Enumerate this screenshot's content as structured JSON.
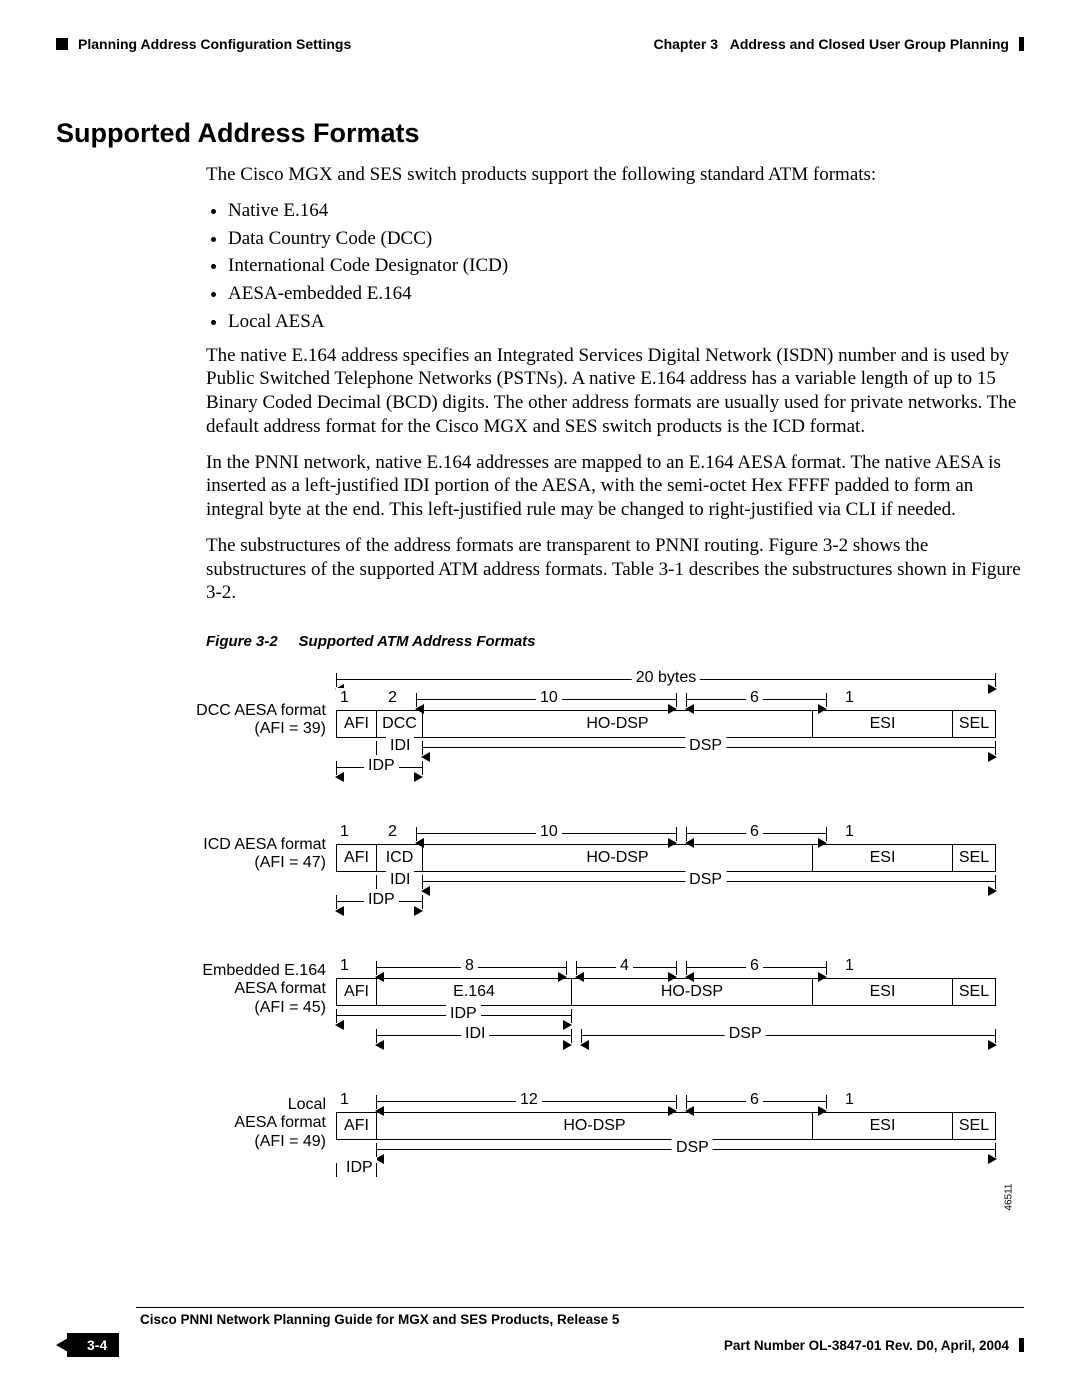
{
  "header": {
    "left": "Planning Address Configuration Settings",
    "right_prefix": "Chapter 3",
    "right_title": "Address and Closed User Group Planning"
  },
  "heading": "Supported Address Formats",
  "intro": "The Cisco MGX and SES switch products support the following standard ATM formats:",
  "bullets": [
    "Native E.164",
    "Data Country Code (DCC)",
    "International Code Designator (ICD)",
    "AESA-embedded E.164",
    "Local AESA"
  ],
  "para1": "The native E.164 address specifies an Integrated Services Digital Network (ISDN) number and is used by Public Switched Telephone Networks (PSTNs). A native E.164 address has a variable length of up to 15 Binary Coded Decimal (BCD) digits. The other address formats are usually used for private networks. The default address format for the Cisco MGX and SES switch products is the ICD format.",
  "para2": "In the PNNI network, native E.164 addresses are mapped to an E.164 AESA format. The native AESA is inserted as a left-justified IDI portion of the AESA, with the semi-octet Hex FFFF padded to form an integral byte at the end. This left-justified rule may be changed to right-justified via CLI if needed.",
  "para3": "The substructures of the address formats are transparent to PNNI routing. Figure 3-2 shows the substructures of the supported ATM address formats. Table 3-1 describes the substructures shown in Figure 3-2.",
  "fig_caption_num": "Figure 3-2",
  "fig_caption_title": "Supported ATM Address Formats",
  "labels": {
    "bytes20": "20 bytes",
    "n1": "1",
    "n2": "2",
    "n4": "4",
    "n6": "6",
    "n8": "8",
    "n10": "10",
    "n12": "12",
    "AFI": "AFI",
    "DCC": "DCC",
    "ICD": "ICD",
    "HODSP": "HO-DSP",
    "ESI": "ESI",
    "SEL": "SEL",
    "E164": "E.164",
    "IDI": "IDI",
    "IDP": "IDP",
    "DSP": "DSP"
  },
  "row_labels": {
    "dcc1": "DCC AESA format",
    "dcc2": "(AFI = 39)",
    "icd1": "ICD AESA format",
    "icd2": "(AFI = 47)",
    "e164_1": "Embedded E.164",
    "e164_2": "AESA format",
    "e164_3": "(AFI = 45)",
    "loc1": "Local",
    "loc2": "AESA format",
    "loc3": "(AFI = 49)"
  },
  "chart_data": {
    "type": "table",
    "total_bytes": 20,
    "formats": [
      {
        "name": "DCC AESA format",
        "afi": 39,
        "fields": [
          {
            "label": "AFI",
            "bytes": 1
          },
          {
            "label": "DCC",
            "bytes": 2
          },
          {
            "label": "HO-DSP",
            "bytes": 10
          },
          {
            "label": "ESI",
            "bytes": 6
          },
          {
            "label": "SEL",
            "bytes": 1
          }
        ],
        "spans": {
          "IDI": [
            "DCC"
          ],
          "IDP": [
            "AFI",
            "DCC"
          ],
          "DSP": [
            "HO-DSP",
            "ESI",
            "SEL"
          ]
        }
      },
      {
        "name": "ICD AESA format",
        "afi": 47,
        "fields": [
          {
            "label": "AFI",
            "bytes": 1
          },
          {
            "label": "ICD",
            "bytes": 2
          },
          {
            "label": "HO-DSP",
            "bytes": 10
          },
          {
            "label": "ESI",
            "bytes": 6
          },
          {
            "label": "SEL",
            "bytes": 1
          }
        ],
        "spans": {
          "IDI": [
            "ICD"
          ],
          "IDP": [
            "AFI",
            "ICD"
          ],
          "DSP": [
            "HO-DSP",
            "ESI",
            "SEL"
          ]
        }
      },
      {
        "name": "Embedded E.164 AESA format",
        "afi": 45,
        "fields": [
          {
            "label": "AFI",
            "bytes": 1
          },
          {
            "label": "E.164",
            "bytes": 8
          },
          {
            "label": "HO-DSP",
            "bytes": 4
          },
          {
            "label": "ESI",
            "bytes": 6
          },
          {
            "label": "SEL",
            "bytes": 1
          }
        ],
        "spans": {
          "IDP": [
            "AFI"
          ],
          "IDI": [
            "AFI",
            "E.164"
          ],
          "DSP": [
            "HO-DSP",
            "ESI",
            "SEL"
          ]
        }
      },
      {
        "name": "Local AESA format",
        "afi": 49,
        "fields": [
          {
            "label": "AFI",
            "bytes": 1
          },
          {
            "label": "HO-DSP",
            "bytes": 12
          },
          {
            "label": "ESI",
            "bytes": 6
          },
          {
            "label": "SEL",
            "bytes": 1
          }
        ],
        "spans": {
          "IDP": [
            "AFI"
          ],
          "DSP": [
            "HO-DSP",
            "ESI",
            "SEL"
          ]
        }
      }
    ]
  },
  "figure_id": "46511",
  "footer": {
    "book": "Cisco PNNI Network Planning Guide  for MGX and SES Products, Release 5",
    "page": "3-4",
    "part": "Part Number OL-3847-01 Rev. D0, April, 2004"
  }
}
